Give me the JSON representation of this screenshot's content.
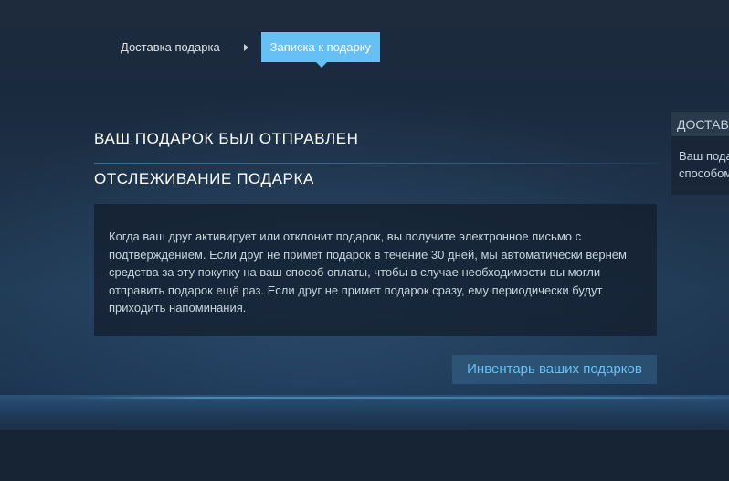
{
  "breadcrumb": {
    "step1_label": "Доставка подарка",
    "step2_label": "Записка к подарку"
  },
  "main": {
    "heading_sent": "ВАШ ПОДАРОК БЫЛ ОТПРАВЛЕН",
    "heading_tracking": "ОТСЛЕЖИВАНИЕ ПОДАРКА",
    "info_text": "Когда ваш друг активирует или отклонит подарок, вы получите электронное письмо с подтверждением. Если друг не примет подарок в течение 30 дней, мы автоматически вернём средства за эту покупку на ваш способ оплаты, чтобы в случае необходимости вы могли отправить подарок ещё раз. Если друг не примет подарок сразу, ему периодически будут приходить напоминания.",
    "inventory_button_label": "Инвентарь ваших подарков"
  },
  "side_panel": {
    "header": "ДОСТАВКА",
    "line1": "Ваш пода",
    "line2": "способом"
  },
  "colors": {
    "accent": "#66c0f4",
    "button_text": "#67c1f5",
    "background": "#1b2838"
  }
}
